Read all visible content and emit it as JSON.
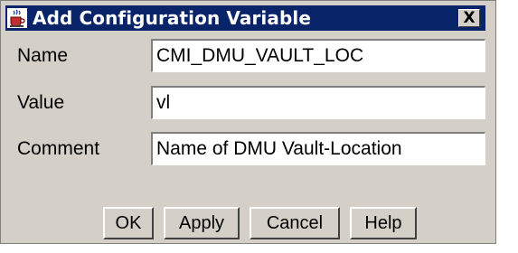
{
  "window": {
    "title": "Add Configuration Variable",
    "close_glyph": "X"
  },
  "form": {
    "name": {
      "label": "Name",
      "value": "CMI_DMU_VAULT_LOC"
    },
    "value": {
      "label": "Value",
      "value": "vl"
    },
    "comment": {
      "label": "Comment",
      "value": "Name of DMU Vault-Location"
    }
  },
  "buttons": {
    "ok": "OK",
    "apply": "Apply",
    "cancel": "Cancel",
    "help": "Help"
  },
  "colors": {
    "titlebar": "#0a246a",
    "window_bg": "#d4d0c8"
  },
  "icons": {
    "app": "java-cup-icon",
    "close": "close-icon"
  }
}
